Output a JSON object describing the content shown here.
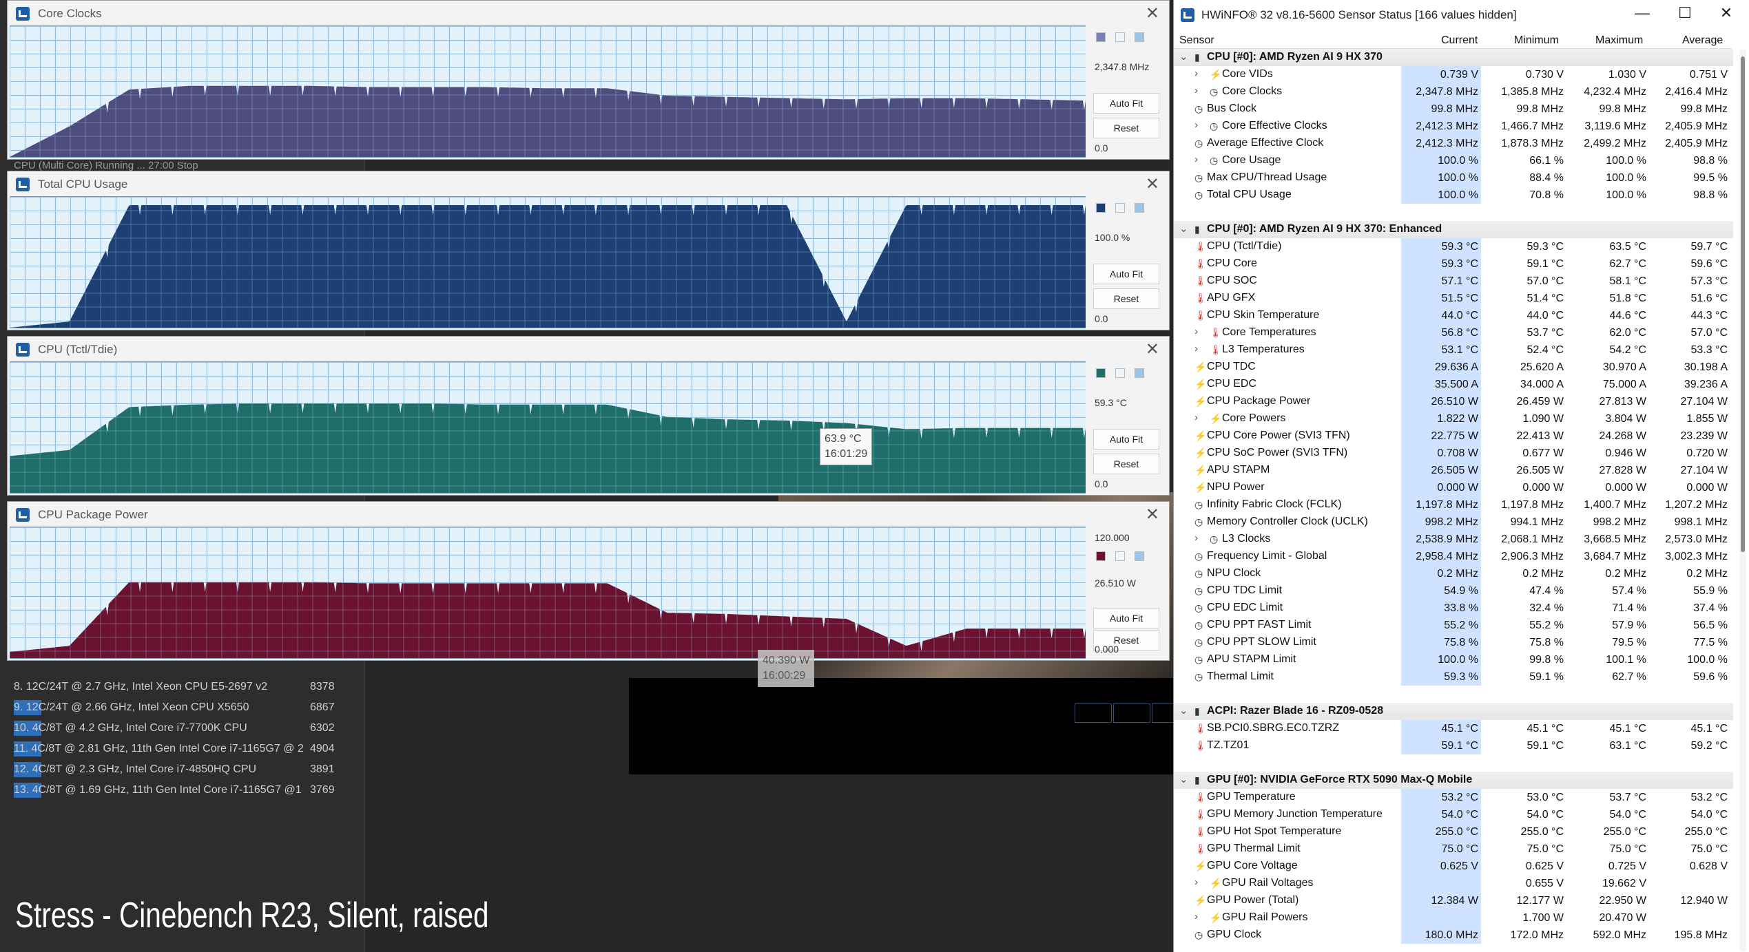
{
  "background": {
    "status_text": "CPU (Multi Core)   Running ...              27:00        Stop",
    "benchmarks": [
      {
        "name": "8. 12C/24T @ 2.7 GHz, Intel Xeon CPU E5-2697 v2",
        "score": "8378",
        "fill": 0.0
      },
      {
        "name": "9. 12C/24T @ 2.66 GHz, Intel Xeon CPU X5650",
        "score": "6867",
        "fill": 0.08
      },
      {
        "name": "10. 4C/8T @ 4.2 GHz, Intel Core i7-7700K CPU",
        "score": "6302",
        "fill": 0.08
      },
      {
        "name": "11. 4C/8T @ 2.81 GHz, 11th Gen Intel Core i7-1165G7 @ 2",
        "score": "4904",
        "fill": 0.08
      },
      {
        "name": "12. 4C/8T @ 2.3 GHz, Intel Core i7-4850HQ CPU",
        "score": "3891",
        "fill": 0.08
      },
      {
        "name": "13. 4C/8T @ 1.69 GHz, 11th Gen Intel Core i7-1165G7 @1",
        "score": "3769",
        "fill": 0.08
      }
    ],
    "caption": "Stress - Cinebench R23, Silent, raised"
  },
  "graphs": [
    {
      "title": "Core Clocks",
      "color": "#4e4d7e",
      "swatch_color": "#7a7fb5",
      "max_label": "0",
      "current_label": "2,347.8 MHz",
      "min_label": "0.0",
      "auto_fit": "Auto Fit",
      "reset": "Reset",
      "chart_data": {
        "type": "area",
        "series": [
          {
            "name": "Core Clocks",
            "profile": [
              0.0,
              0.25,
              0.55,
              0.58,
              0.58,
              0.58,
              0.57,
              0.57,
              0.57,
              0.56,
              0.56,
              0.5,
              0.49,
              0.48,
              0.47,
              0.48,
              0.48,
              0.47,
              0.46
            ]
          }
        ]
      }
    },
    {
      "title": "Total CPU Usage",
      "color": "#1d3f73",
      "swatch_color": "#1d3f73",
      "max_label": "0",
      "current_label": "100.0 %",
      "min_label": "0.0",
      "auto_fit": "Auto Fit",
      "reset": "Reset",
      "chart_data": {
        "type": "area",
        "series": [
          {
            "name": "Total CPU Usage",
            "profile": [
              0.0,
              0.05,
              1.0,
              1.0,
              1.0,
              1.0,
              1.0,
              1.0,
              1.0,
              1.0,
              1.0,
              1.0,
              1.0,
              1.0,
              0.05,
              1.0,
              1.0,
              1.0,
              1.0
            ]
          }
        ]
      }
    },
    {
      "title": "CPU (Tctl/Tdie)",
      "color": "#1f6e6a",
      "swatch_color": "#1f6e6a",
      "max_label": "",
      "current_label": "59.3 °C",
      "min_label": "0.0",
      "auto_fit": "Auto Fit",
      "reset": "Reset",
      "tooltip": {
        "value": "63.9 °C",
        "time": "16:01:29"
      },
      "chart_data": {
        "type": "area",
        "series": [
          {
            "name": "CPU (Tctl/Tdie)",
            "profile": [
              0.3,
              0.35,
              0.7,
              0.72,
              0.73,
              0.73,
              0.73,
              0.73,
              0.72,
              0.72,
              0.72,
              0.62,
              0.6,
              0.59,
              0.57,
              0.52,
              0.53,
              0.53,
              0.53
            ]
          }
        ]
      }
    },
    {
      "title": "CPU Package Power",
      "color": "#6a1230",
      "swatch_color": "#6a1230",
      "max_label": "120.000",
      "current_label": "26.510 W",
      "min_label": "0.000",
      "auto_fit": "Auto Fit",
      "reset": "Reset",
      "tooltip": {
        "value": "40.390 W",
        "time": "16:00:29"
      },
      "chart_data": {
        "type": "area",
        "series": [
          {
            "name": "CPU Package Power",
            "profile": [
              0.05,
              0.1,
              0.62,
              0.62,
              0.62,
              0.62,
              0.61,
              0.61,
              0.61,
              0.61,
              0.61,
              0.37,
              0.36,
              0.34,
              0.32,
              0.1,
              0.24,
              0.24,
              0.24
            ]
          }
        ]
      }
    }
  ],
  "hwinfo": {
    "title": "HWiNFO® 32 v8.16-5600 Sensor Status [166 values hidden]",
    "columns": {
      "sensor": "Sensor",
      "current": "Current",
      "minimum": "Minimum",
      "maximum": "Maximum",
      "average": "Average"
    },
    "rows": [
      {
        "type": "group",
        "label": "CPU [#0]: AMD Ryzen AI 9 HX 370"
      },
      {
        "type": "item",
        "expand": true,
        "icon": "bolt",
        "label": "Core VIDs",
        "cur": "0.739 V",
        "min": "0.730 V",
        "max": "1.030 V",
        "avg": "0.751 V"
      },
      {
        "type": "item",
        "expand": true,
        "icon": "clock",
        "label": "Core Clocks",
        "cur": "2,347.8 MHz",
        "min": "1,385.8 MHz",
        "max": "4,232.4 MHz",
        "avg": "2,416.4 MHz"
      },
      {
        "type": "item",
        "icon": "clock",
        "label": "Bus Clock",
        "cur": "99.8 MHz",
        "min": "99.8 MHz",
        "max": "99.8 MHz",
        "avg": "99.8 MHz"
      },
      {
        "type": "item",
        "expand": true,
        "icon": "clock",
        "label": "Core Effective Clocks",
        "cur": "2,412.3 MHz",
        "min": "1,466.7 MHz",
        "max": "3,119.6 MHz",
        "avg": "2,405.9 MHz"
      },
      {
        "type": "item",
        "icon": "clock",
        "label": "Average Effective Clock",
        "cur": "2,412.3 MHz",
        "min": "1,878.3 MHz",
        "max": "2,499.2 MHz",
        "avg": "2,405.9 MHz"
      },
      {
        "type": "item",
        "expand": true,
        "icon": "clock",
        "label": "Core Usage",
        "cur": "100.0 %",
        "min": "66.1 %",
        "max": "100.0 %",
        "avg": "98.8 %"
      },
      {
        "type": "item",
        "icon": "clock",
        "label": "Max CPU/Thread Usage",
        "cur": "100.0 %",
        "min": "88.4 %",
        "max": "100.0 %",
        "avg": "99.5 %"
      },
      {
        "type": "item",
        "icon": "clock",
        "label": "Total CPU Usage",
        "cur": "100.0 %",
        "min": "70.8 %",
        "max": "100.0 %",
        "avg": "98.8 %"
      },
      {
        "type": "spacer"
      },
      {
        "type": "group",
        "label": "CPU [#0]: AMD Ryzen AI 9 HX 370: Enhanced"
      },
      {
        "type": "item",
        "icon": "therm",
        "label": "CPU (Tctl/Tdie)",
        "cur": "59.3 °C",
        "min": "59.3 °C",
        "max": "63.5 °C",
        "avg": "59.7 °C"
      },
      {
        "type": "item",
        "icon": "therm",
        "label": "CPU Core",
        "cur": "59.3 °C",
        "min": "59.1 °C",
        "max": "62.7 °C",
        "avg": "59.6 °C"
      },
      {
        "type": "item",
        "icon": "therm",
        "label": "CPU SOC",
        "cur": "57.1 °C",
        "min": "57.0 °C",
        "max": "58.1 °C",
        "avg": "57.3 °C"
      },
      {
        "type": "item",
        "icon": "therm",
        "label": "APU GFX",
        "cur": "51.5 °C",
        "min": "51.4 °C",
        "max": "51.8 °C",
        "avg": "51.6 °C"
      },
      {
        "type": "item",
        "icon": "therm",
        "label": "CPU Skin Temperature",
        "cur": "44.0 °C",
        "min": "44.0 °C",
        "max": "44.6 °C",
        "avg": "44.3 °C"
      },
      {
        "type": "item",
        "expand": true,
        "icon": "therm",
        "label": "Core Temperatures",
        "cur": "56.8 °C",
        "min": "53.7 °C",
        "max": "62.0 °C",
        "avg": "57.0 °C"
      },
      {
        "type": "item",
        "expand": true,
        "icon": "therm",
        "label": "L3 Temperatures",
        "cur": "53.1 °C",
        "min": "52.4 °C",
        "max": "54.2 °C",
        "avg": "53.3 °C"
      },
      {
        "type": "item",
        "icon": "bolt",
        "label": "CPU TDC",
        "cur": "29.636 A",
        "min": "25.620 A",
        "max": "30.970 A",
        "avg": "30.198 A"
      },
      {
        "type": "item",
        "icon": "bolt",
        "label": "CPU EDC",
        "cur": "35.500 A",
        "min": "34.000 A",
        "max": "75.000 A",
        "avg": "39.236 A"
      },
      {
        "type": "item",
        "icon": "bolt",
        "label": "CPU Package Power",
        "cur": "26.510 W",
        "min": "26.459 W",
        "max": "27.813 W",
        "avg": "27.104 W"
      },
      {
        "type": "item",
        "expand": true,
        "icon": "bolt",
        "label": "Core Powers",
        "cur": "1.822 W",
        "min": "1.090 W",
        "max": "3.804 W",
        "avg": "1.855 W"
      },
      {
        "type": "item",
        "icon": "bolt",
        "label": "CPU Core Power (SVI3 TFN)",
        "cur": "22.775 W",
        "min": "22.413 W",
        "max": "24.268 W",
        "avg": "23.239 W"
      },
      {
        "type": "item",
        "icon": "bolt",
        "label": "CPU SoC Power (SVI3 TFN)",
        "cur": "0.708 W",
        "min": "0.677 W",
        "max": "0.946 W",
        "avg": "0.720 W"
      },
      {
        "type": "item",
        "icon": "bolt",
        "label": "APU STAPM",
        "cur": "26.505 W",
        "min": "26.505 W",
        "max": "27.828 W",
        "avg": "27.104 W"
      },
      {
        "type": "item",
        "icon": "bolt",
        "label": "NPU Power",
        "cur": "0.000 W",
        "min": "0.000 W",
        "max": "0.000 W",
        "avg": "0.000 W"
      },
      {
        "type": "item",
        "icon": "clock",
        "label": "Infinity Fabric Clock (FCLK)",
        "cur": "1,197.8 MHz",
        "min": "1,197.8 MHz",
        "max": "1,400.7 MHz",
        "avg": "1,207.2 MHz"
      },
      {
        "type": "item",
        "icon": "clock",
        "label": "Memory Controller Clock (UCLK)",
        "cur": "998.2 MHz",
        "min": "994.1 MHz",
        "max": "998.2 MHz",
        "avg": "998.1 MHz"
      },
      {
        "type": "item",
        "expand": true,
        "icon": "clock",
        "label": "L3 Clocks",
        "cur": "2,538.9 MHz",
        "min": "2,068.1 MHz",
        "max": "3,668.5 MHz",
        "avg": "2,573.0 MHz"
      },
      {
        "type": "item",
        "icon": "clock",
        "label": "Frequency Limit - Global",
        "cur": "2,958.4 MHz",
        "min": "2,906.3 MHz",
        "max": "3,684.7 MHz",
        "avg": "3,002.3 MHz"
      },
      {
        "type": "item",
        "icon": "clock",
        "label": "NPU Clock",
        "cur": "0.2 MHz",
        "min": "0.2 MHz",
        "max": "0.2 MHz",
        "avg": "0.2 MHz"
      },
      {
        "type": "item",
        "icon": "clock",
        "label": "CPU TDC Limit",
        "cur": "54.9 %",
        "min": "47.4 %",
        "max": "57.4 %",
        "avg": "55.9 %"
      },
      {
        "type": "item",
        "icon": "clock",
        "label": "CPU EDC Limit",
        "cur": "33.8 %",
        "min": "32.4 %",
        "max": "71.4 %",
        "avg": "37.4 %"
      },
      {
        "type": "item",
        "icon": "clock",
        "label": "CPU PPT FAST Limit",
        "cur": "55.2 %",
        "min": "55.2 %",
        "max": "57.9 %",
        "avg": "56.5 %"
      },
      {
        "type": "item",
        "icon": "clock",
        "label": "CPU PPT SLOW Limit",
        "cur": "75.8 %",
        "min": "75.8 %",
        "max": "79.5 %",
        "avg": "77.5 %"
      },
      {
        "type": "item",
        "icon": "clock",
        "label": "APU STAPM Limit",
        "cur": "100.0 %",
        "min": "99.8 %",
        "max": "100.1 %",
        "avg": "100.0 %"
      },
      {
        "type": "item",
        "icon": "clock",
        "label": "Thermal Limit",
        "cur": "59.3 %",
        "min": "59.1 %",
        "max": "62.7 %",
        "avg": "59.6 %"
      },
      {
        "type": "spacer"
      },
      {
        "type": "group",
        "label": "ACPI: Razer Blade 16 - RZ09-0528"
      },
      {
        "type": "item",
        "icon": "therm",
        "label": "SB.PCI0.SBRG.EC0.TZRZ",
        "cur": "45.1 °C",
        "min": "45.1 °C",
        "max": "45.1 °C",
        "avg": "45.1 °C"
      },
      {
        "type": "item",
        "icon": "therm",
        "label": "TZ.TZ01",
        "cur": "59.1 °C",
        "min": "59.1 °C",
        "max": "63.1 °C",
        "avg": "59.2 °C"
      },
      {
        "type": "spacer"
      },
      {
        "type": "group",
        "label": "GPU [#0]: NVIDIA  GeForce RTX 5090 Max-Q Mobile"
      },
      {
        "type": "item",
        "icon": "therm",
        "label": "GPU Temperature",
        "cur": "53.2 °C",
        "min": "53.0 °C",
        "max": "53.7 °C",
        "avg": "53.2 °C"
      },
      {
        "type": "item",
        "icon": "therm",
        "label": "GPU Memory Junction Temperature",
        "cur": "54.0 °C",
        "min": "54.0 °C",
        "max": "54.0 °C",
        "avg": "54.0 °C"
      },
      {
        "type": "item",
        "icon": "therm",
        "label": "GPU Hot Spot Temperature",
        "cur": "255.0 °C",
        "min": "255.0 °C",
        "max": "255.0 °C",
        "avg": "255.0 °C"
      },
      {
        "type": "item",
        "icon": "therm",
        "label": "GPU Thermal Limit",
        "cur": "75.0 °C",
        "min": "75.0 °C",
        "max": "75.0 °C",
        "avg": "75.0 °C"
      },
      {
        "type": "item",
        "icon": "bolt",
        "label": "GPU Core Voltage",
        "cur": "0.625 V",
        "min": "0.625 V",
        "max": "0.725 V",
        "avg": "0.628 V"
      },
      {
        "type": "item",
        "expand": true,
        "icon": "bolt",
        "label": "GPU Rail Voltages",
        "cur": "",
        "min": "0.655 V",
        "max": "19.662 V",
        "avg": ""
      },
      {
        "type": "item",
        "icon": "bolt",
        "label": "GPU Power (Total)",
        "cur": "12.384 W",
        "min": "12.177 W",
        "max": "22.950 W",
        "avg": "12.940 W"
      },
      {
        "type": "item",
        "expand": true,
        "icon": "bolt",
        "label": "GPU Rail Powers",
        "cur": "",
        "min": "1.700 W",
        "max": "20.470 W",
        "avg": ""
      },
      {
        "type": "item",
        "icon": "clock",
        "label": "GPU Clock",
        "cur": "180.0 MHz",
        "min": "172.0 MHz",
        "max": "592.0 MHz",
        "avg": "195.8 MHz"
      }
    ]
  }
}
